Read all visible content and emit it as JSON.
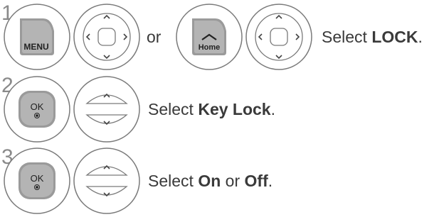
{
  "steps": [
    {
      "number": "1",
      "menu_label": "MENU",
      "or_label": "or",
      "home_label": "Home",
      "text": {
        "before": "Select ",
        "bold": "LOCK",
        "after": "."
      }
    },
    {
      "number": "2",
      "ok_label": "OK",
      "text": {
        "before": "Select ",
        "bold": "Key Lock",
        "after": "."
      }
    },
    {
      "number": "3",
      "ok_label": "OK",
      "text": {
        "before": "Select ",
        "bold": "On",
        "middle": " or ",
        "bold2": "Off",
        "after": "."
      }
    }
  ],
  "icons": {
    "menu": "menu-button-icon",
    "home": "home-button-icon",
    "nav": "navigation-pad-icon",
    "ok": "ok-button-icon",
    "updown": "up-down-button-icon"
  }
}
